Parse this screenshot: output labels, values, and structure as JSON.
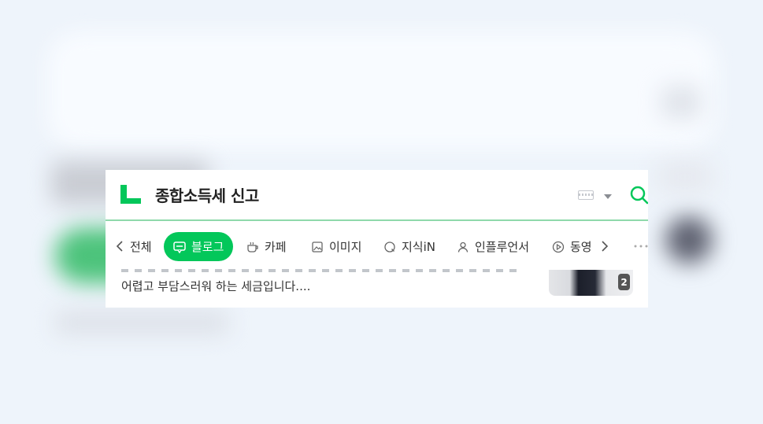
{
  "search": {
    "query": "종합소득세 신고"
  },
  "tabs": [
    {
      "label": "전체",
      "icon": "chevron-left-icon"
    },
    {
      "label": "블로그",
      "icon": "blog-icon",
      "active": true
    },
    {
      "label": "카페",
      "icon": "cafe-cup-icon"
    },
    {
      "label": "이미지",
      "icon": "image-icon"
    },
    {
      "label": "지식iN",
      "icon": "kin-icon"
    },
    {
      "label": "인플루언서",
      "icon": "person-icon"
    },
    {
      "label": "동영",
      "icon": "play-icon"
    }
  ],
  "result": {
    "snippet": "어렵고 부담스러워 하는 세금입니다....",
    "thumb_count": "2"
  },
  "colors": {
    "brand": "#03c75a",
    "divider": "#8fd9ab"
  }
}
